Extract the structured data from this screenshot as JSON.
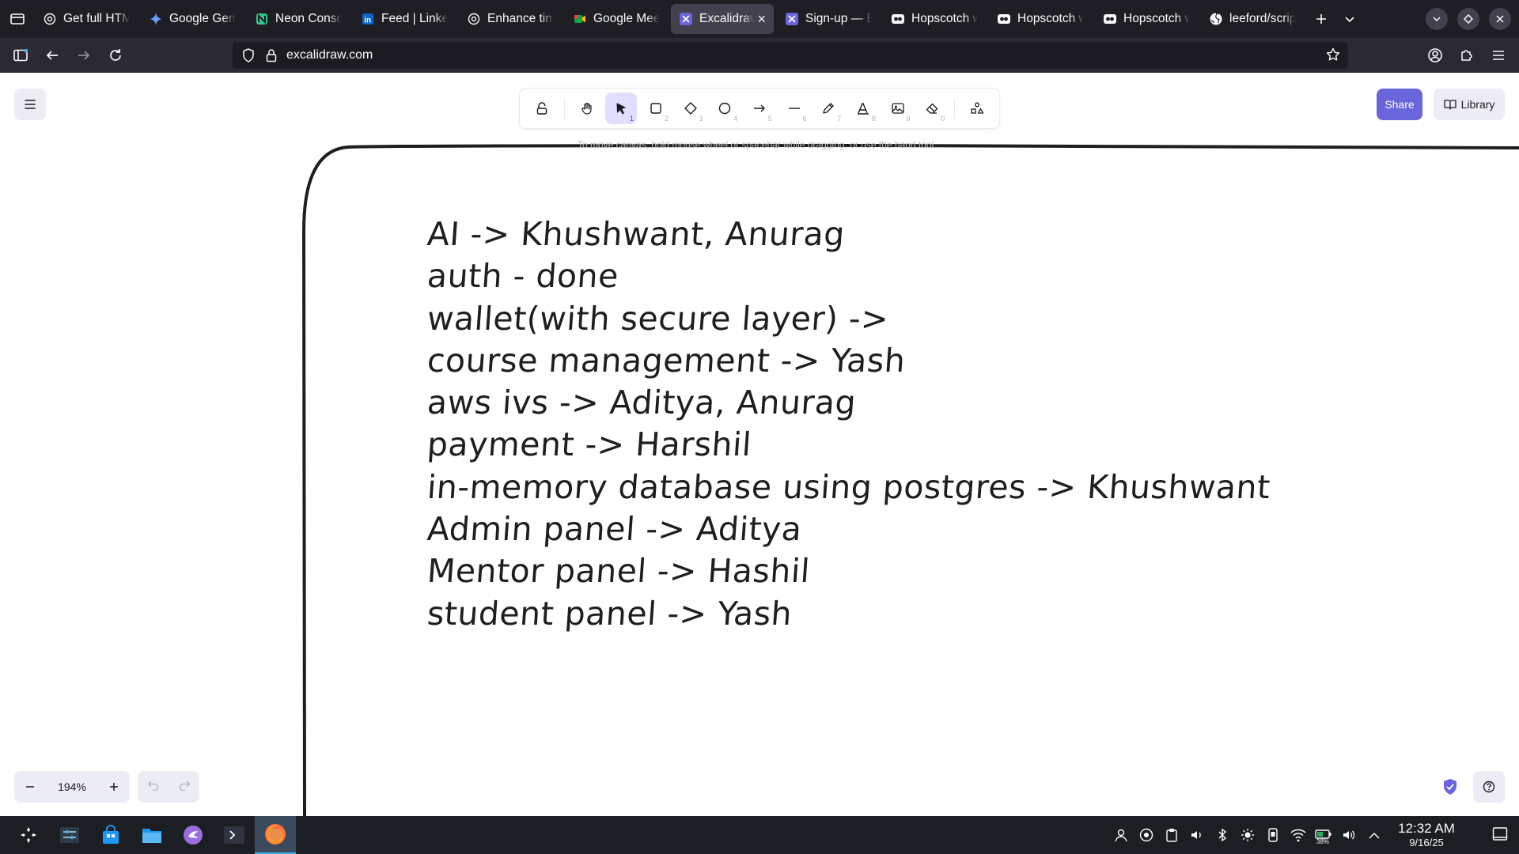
{
  "browser": {
    "tabs": [
      {
        "title": "Get full HTM",
        "favicon": "openai-icon",
        "fav_color": "#fbfbfe"
      },
      {
        "title": "Google Gem",
        "favicon": "gemini-icon",
        "fav_color": "#6a9bff"
      },
      {
        "title": "Neon Conso",
        "favicon": "neon-icon",
        "fav_color": "#37c38f"
      },
      {
        "title": "Feed | Linke",
        "favicon": "linkedin-icon",
        "fav_color": "#0a66c2"
      },
      {
        "title": "Enhance tim",
        "favicon": "openai-icon",
        "fav_color": "#fbfbfe"
      },
      {
        "title": "Google Meet",
        "favicon": "meet-icon",
        "fav_color": "#00ac47"
      },
      {
        "title": "Excalidraw",
        "favicon": "excalidraw-icon",
        "fav_color": "#6965db",
        "active": true
      },
      {
        "title": "Sign-up — E",
        "favicon": "excalidraw-icon",
        "fav_color": "#6965db"
      },
      {
        "title": "Hopscotch w",
        "favicon": "hopscotch-icon",
        "fav_color": "#fbfbfe"
      },
      {
        "title": "Hopscotch w",
        "favicon": "hopscotch-icon",
        "fav_color": "#fbfbfe"
      },
      {
        "title": "Hopscotch w",
        "favicon": "hopscotch-icon",
        "fav_color": "#fbfbfe"
      },
      {
        "title": "leeford/scrip",
        "favicon": "github-icon",
        "fav_color": "#fbfbfe"
      }
    ],
    "url": "excalidraw.com"
  },
  "excalidraw": {
    "tools": [
      {
        "name": "lock-tool",
        "key": ""
      },
      {
        "name": "hand-tool",
        "key": ""
      },
      {
        "name": "selection-tool",
        "key": "1",
        "active": true
      },
      {
        "name": "rectangle-tool",
        "key": "2"
      },
      {
        "name": "diamond-tool",
        "key": "3"
      },
      {
        "name": "ellipse-tool",
        "key": "4"
      },
      {
        "name": "arrow-tool",
        "key": "5"
      },
      {
        "name": "line-tool",
        "key": "6"
      },
      {
        "name": "draw-tool",
        "key": "7"
      },
      {
        "name": "text-tool",
        "key": "8"
      },
      {
        "name": "image-tool",
        "key": "9"
      },
      {
        "name": "eraser-tool",
        "key": "0"
      },
      {
        "name": "extra-tools",
        "key": ""
      }
    ],
    "share_label": "Share",
    "library_label": "Library",
    "hint": "To move canvas, hold mouse wheel or spacebar while dragging, or use the hand tool",
    "zoom": "194%",
    "notes": [
      "AI -> Khushwant, Anurag",
      "auth - done",
      "wallet(with secure layer) ->",
      "course management -> Yash",
      "aws ivs -> Aditya, Anurag",
      "payment -> Harshil",
      "in-memory database using postgres -> Khushwant",
      "Admin panel -> Aditya",
      "Mentor panel -> Hashil",
      "student panel -> Yash"
    ],
    "accent": "#6965db"
  },
  "taskbar": {
    "time": "12:32 AM",
    "date": "9/16/25",
    "battery": "38%"
  }
}
